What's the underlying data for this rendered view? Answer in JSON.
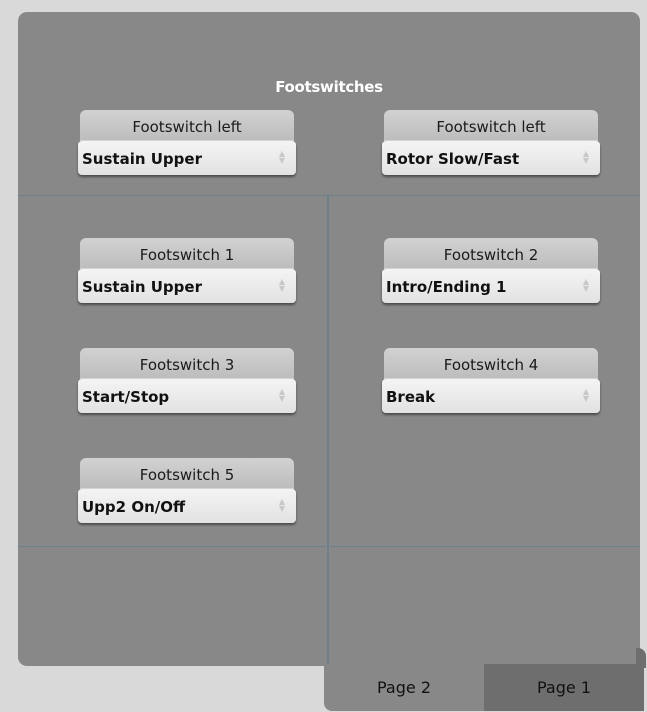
{
  "title": "Footswitches",
  "footswitches": [
    {
      "label": "Footswitch left",
      "value": "Sustain Upper"
    },
    {
      "label": "Footswitch left",
      "value": "Rotor Slow/Fast"
    },
    {
      "label": "Footswitch 1",
      "value": "Sustain Upper"
    },
    {
      "label": "Footswitch 2",
      "value": "Intro/Ending 1"
    },
    {
      "label": "Footswitch 3",
      "value": "Start/Stop"
    },
    {
      "label": "Footswitch 4",
      "value": "Break"
    },
    {
      "label": "Footswitch 5",
      "value": "Upp2 On/Off"
    }
  ],
  "tabs": [
    {
      "label": "Page 2",
      "active": true
    },
    {
      "label": "Page 1",
      "active": false
    }
  ],
  "colors": {
    "panel": "#888888",
    "divider": "#6d7f8a",
    "label_bg": "#c8c8c8",
    "select_bg": "#eeeeee",
    "inactive_tab": "#6e6e6e"
  }
}
